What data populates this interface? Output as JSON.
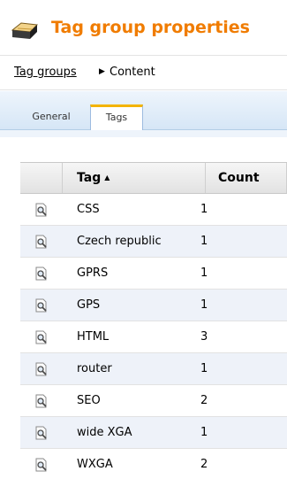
{
  "header": {
    "title": "Tag group properties",
    "icon": "tag-group-icon"
  },
  "breadcrumb": {
    "parent": "Tag groups",
    "separator": "▶",
    "current": "Content"
  },
  "tabs": [
    {
      "label": "General",
      "selected": false
    },
    {
      "label": "Tags",
      "selected": true
    }
  ],
  "grid": {
    "columns": {
      "tag": "Tag",
      "count": "Count",
      "sort_indicator": "▲"
    },
    "rows": [
      {
        "tag": "CSS",
        "count": "1"
      },
      {
        "tag": "Czech republic",
        "count": "1"
      },
      {
        "tag": "GPRS",
        "count": "1"
      },
      {
        "tag": "GPS",
        "count": "1"
      },
      {
        "tag": "HTML",
        "count": "3"
      },
      {
        "tag": "router",
        "count": "1"
      },
      {
        "tag": "SEO",
        "count": "2"
      },
      {
        "tag": "wide XGA",
        "count": "1"
      },
      {
        "tag": "WXGA",
        "count": "2"
      }
    ]
  },
  "colors": {
    "title": "#f07c00",
    "tab_accent": "#f3b400",
    "alt_row": "#eef2f9"
  }
}
